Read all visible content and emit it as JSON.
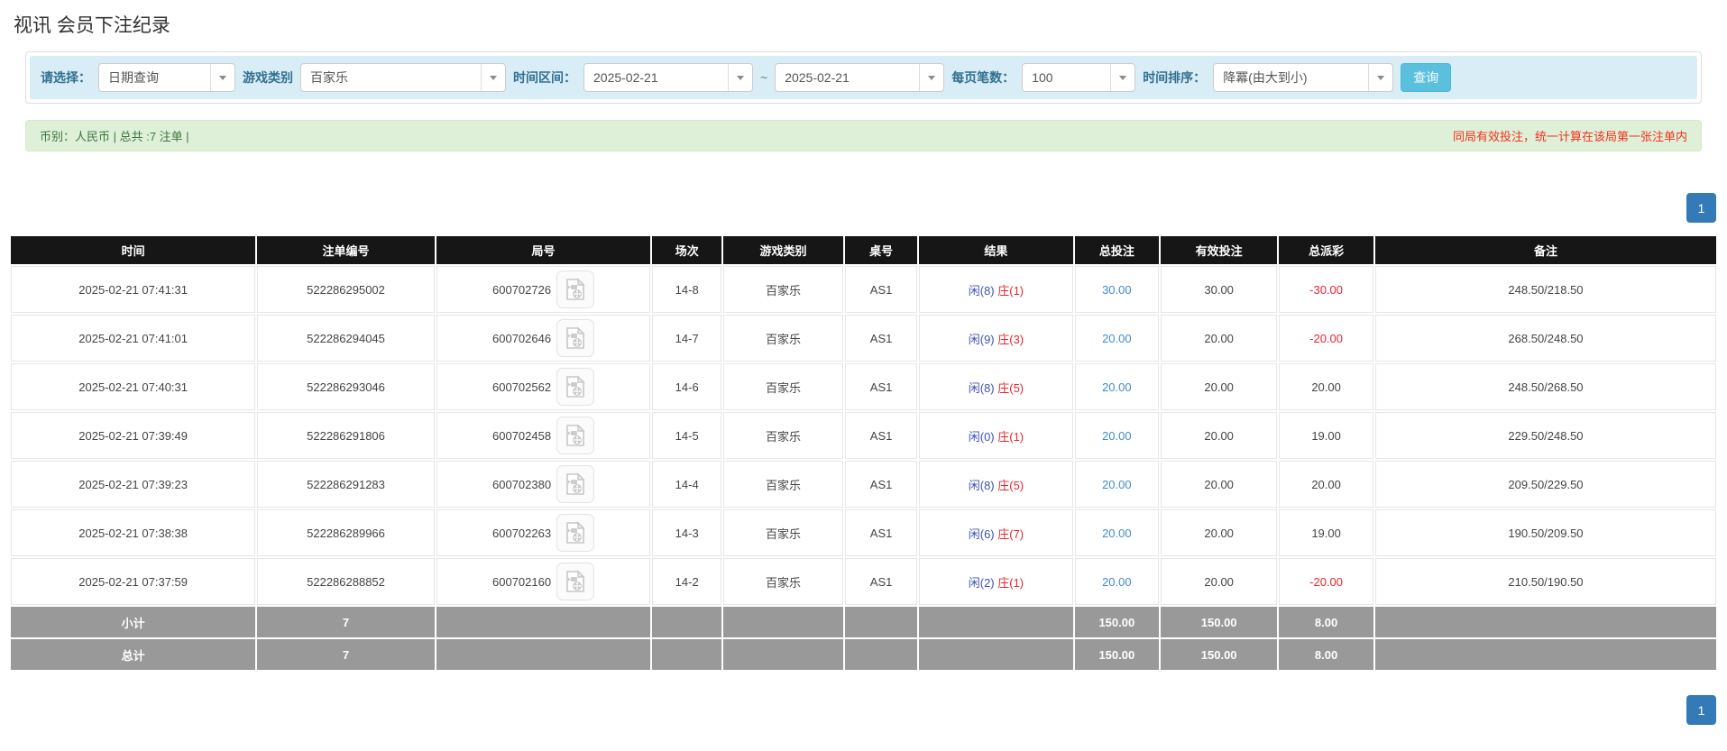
{
  "page": {
    "title": "视讯 会员下注纪录"
  },
  "colors": {
    "filter_bar_bg": "#d9edf7",
    "filter_label": "#31708f",
    "search_button": "#5bc0de",
    "alert_bg": "#dff0d8",
    "alert_text": "#3c763d",
    "alert_warning_text": "#f4301e",
    "table_header_bg": "#161616",
    "table_footer_bg": "#999999",
    "player_blue": "#3f51b5",
    "banker_red": "#e4262d",
    "amount_link_blue": "#428bca",
    "negative_red": "#e4262d",
    "pagination_active_bg": "#337ab7"
  },
  "filters": {
    "query_type": {
      "label": "请选择：",
      "value": "日期查询"
    },
    "game_category": {
      "label": "游戏类别",
      "value": "百家乐"
    },
    "date_range": {
      "label": "时间区间：",
      "from": "2025-02-21",
      "separator": "~",
      "to": "2025-02-21"
    },
    "page_size": {
      "label": "每页笔数：",
      "value": "100"
    },
    "time_sort": {
      "label": "时间排序：",
      "value": "降冪(由大到小)"
    },
    "search_button": "查询"
  },
  "summary": {
    "left": "币别：人民币 | 总共 :7 注单 |",
    "right": "同局有效投注，统一计算在该局第一张注单内"
  },
  "pagination": {
    "top": "1",
    "bottom": "1"
  },
  "table": {
    "headers": [
      "时间",
      "注单编号",
      "局号",
      "场次",
      "游戏类别",
      "桌号",
      "结果",
      "总投注",
      "有效投注",
      "总派彩",
      "备注"
    ],
    "rows": [
      {
        "time": "2025-02-21 07:41:31",
        "bet_id": "522286295002",
        "round_id": "600702726",
        "session": "14-8",
        "game": "百家乐",
        "table": "AS1",
        "result_player": "闲(8)",
        "result_banker": "庄(1)",
        "total_bet": "30.00",
        "valid_bet": "30.00",
        "payout": "-30.00",
        "note": "248.50/218.50"
      },
      {
        "time": "2025-02-21 07:41:01",
        "bet_id": "522286294045",
        "round_id": "600702646",
        "session": "14-7",
        "game": "百家乐",
        "table": "AS1",
        "result_player": "闲(9)",
        "result_banker": "庄(3)",
        "total_bet": "20.00",
        "valid_bet": "20.00",
        "payout": "-20.00",
        "note": "268.50/248.50"
      },
      {
        "time": "2025-02-21 07:40:31",
        "bet_id": "522286293046",
        "round_id": "600702562",
        "session": "14-6",
        "game": "百家乐",
        "table": "AS1",
        "result_player": "闲(8)",
        "result_banker": "庄(5)",
        "total_bet": "20.00",
        "valid_bet": "20.00",
        "payout": "20.00",
        "note": "248.50/268.50"
      },
      {
        "time": "2025-02-21 07:39:49",
        "bet_id": "522286291806",
        "round_id": "600702458",
        "session": "14-5",
        "game": "百家乐",
        "table": "AS1",
        "result_player": "闲(0)",
        "result_banker": "庄(1)",
        "total_bet": "20.00",
        "valid_bet": "20.00",
        "payout": "19.00",
        "note": "229.50/248.50"
      },
      {
        "time": "2025-02-21 07:39:23",
        "bet_id": "522286291283",
        "round_id": "600702380",
        "session": "14-4",
        "game": "百家乐",
        "table": "AS1",
        "result_player": "闲(8)",
        "result_banker": "庄(5)",
        "total_bet": "20.00",
        "valid_bet": "20.00",
        "payout": "20.00",
        "note": "209.50/229.50"
      },
      {
        "time": "2025-02-21 07:38:38",
        "bet_id": "522286289966",
        "round_id": "600702263",
        "session": "14-3",
        "game": "百家乐",
        "table": "AS1",
        "result_player": "闲(6)",
        "result_banker": "庄(7)",
        "total_bet": "20.00",
        "valid_bet": "20.00",
        "payout": "19.00",
        "note": "190.50/209.50"
      },
      {
        "time": "2025-02-21 07:37:59",
        "bet_id": "522286288852",
        "round_id": "600702160",
        "session": "14-2",
        "game": "百家乐",
        "table": "AS1",
        "result_player": "闲(2)",
        "result_banker": "庄(1)",
        "total_bet": "20.00",
        "valid_bet": "20.00",
        "payout": "-20.00",
        "note": "210.50/190.50"
      }
    ],
    "subtotal": {
      "label": "小计",
      "count": "7",
      "total_bet": "150.00",
      "valid_bet": "150.00",
      "payout": "8.00"
    },
    "total": {
      "label": "总计",
      "count": "7",
      "total_bet": "150.00",
      "valid_bet": "150.00",
      "payout": "8.00"
    }
  }
}
